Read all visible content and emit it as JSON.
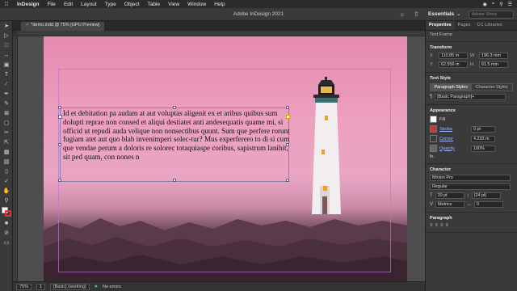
{
  "menubar": {
    "app": "InDesign",
    "items": [
      "File",
      "Edit",
      "Layout",
      "Type",
      "Object",
      "Table",
      "View",
      "Window",
      "Help"
    ]
  },
  "appbar": {
    "title": "Adobe InDesign 2021",
    "workspace": "Essentials",
    "search_placeholder": "Adobe Stock"
  },
  "document": {
    "tab": "*demo.indd @ 75% [GPU Preview]",
    "story": "Id et debitation pa audam at aut voluptas aligenit ex et aribus quibus sum dolupti reprae non consed et aliqui destiatet anti andesequatis quame mi, si officid ut repudi auda velique non nonsectibus quunt. Sum que perfere rorunt fugiam atet aut quo blab invenimperi solec-tur? Mus experferero to di si cum que vendae perum a doloris re solorec totaquiaspe coribus, sapistrum lanihit, sit ped quam, con nones n"
  },
  "status": {
    "zoom": "75%",
    "page": "1",
    "style": "[Basic] (working)",
    "errors": "No errors"
  },
  "panel": {
    "tabs": [
      "Properties",
      "Pages",
      "CC Libraries"
    ],
    "selection": "Text Frame",
    "transform": {
      "heading": "Transform",
      "x_label": "X",
      "x": "110.85 m",
      "y_label": "Y",
      "y": "62.556 m",
      "w_label": "W",
      "w": "196.3 mm",
      "h_label": "H",
      "h": "61.5 mm"
    },
    "text_style": {
      "heading": "Text Style",
      "tabs": [
        "Paragraph Styles",
        "Character Styles"
      ],
      "value": "[Basic Paragraph]+"
    },
    "appearance": {
      "heading": "Appearance",
      "fill": "Fill",
      "stroke": "Stroke",
      "stroke_weight": "0 pt",
      "corner": "Corner",
      "corner_value": "4.233 m",
      "opacity": "Opacity",
      "opacity_value": "100%",
      "fx": "fx."
    },
    "character": {
      "heading": "Character",
      "font": "Minion Pro",
      "style": "Regular",
      "size": "20 pt",
      "leading": "(24 pt)",
      "kerning": "Metrics",
      "tracking": "0"
    },
    "paragraph": {
      "heading": "Paragraph"
    }
  }
}
